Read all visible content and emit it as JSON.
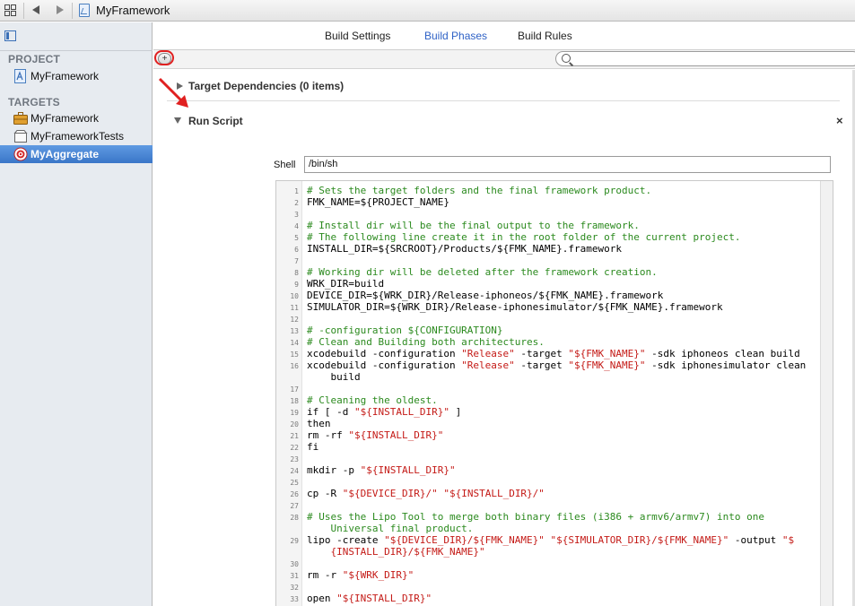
{
  "jumpbar": {
    "title": "MyFramework",
    "icons": [
      "grid-icon",
      "back-arrow-icon",
      "forward-arrow-icon",
      "project-file-icon"
    ]
  },
  "sidebar": {
    "project_header": "PROJECT",
    "project_items": [
      {
        "label": "MyFramework",
        "icon": "project-icon"
      }
    ],
    "targets_header": "TARGETS",
    "target_items": [
      {
        "label": "MyFramework",
        "icon": "framework-toolbox-icon",
        "selected": false
      },
      {
        "label": "MyFrameworkTests",
        "icon": "test-bundle-icon",
        "selected": false
      },
      {
        "label": "MyAggregate",
        "icon": "aggregate-target-icon",
        "selected": true
      }
    ]
  },
  "tabs": [
    {
      "label": "Build Settings",
      "active": false
    },
    {
      "label": "Build Phases",
      "active": true
    },
    {
      "label": "Build Rules",
      "active": false
    }
  ],
  "filter": {
    "search_placeholder": ""
  },
  "phases": {
    "target_dependencies": "Target Dependencies (0 items)",
    "run_script": "Run Script",
    "close_symbol": "×",
    "shell_label": "Shell",
    "shell_value": "/bin/sh"
  },
  "code_lines": [
    {
      "n": "1",
      "segs": [
        {
          "t": "# Sets the target folders and the final framework product.",
          "k": "c"
        }
      ]
    },
    {
      "n": "2",
      "segs": [
        {
          "t": "FMK_NAME=${PROJECT_NAME}",
          "k": ""
        }
      ]
    },
    {
      "n": "3",
      "segs": []
    },
    {
      "n": "4",
      "segs": [
        {
          "t": "# Install dir will be the final output to the framework.",
          "k": "c"
        }
      ]
    },
    {
      "n": "5",
      "segs": [
        {
          "t": "# The following line create it in the root folder of the current project.",
          "k": "c"
        }
      ]
    },
    {
      "n": "6",
      "segs": [
        {
          "t": "INSTALL_DIR=${SRCROOT}/Products/${FMK_NAME}.framework",
          "k": ""
        }
      ]
    },
    {
      "n": "7",
      "segs": []
    },
    {
      "n": "8",
      "segs": [
        {
          "t": "# Working dir will be deleted after the framework creation.",
          "k": "c"
        }
      ]
    },
    {
      "n": "9",
      "segs": [
        {
          "t": "WRK_DIR=build",
          "k": ""
        }
      ]
    },
    {
      "n": "10",
      "segs": [
        {
          "t": "DEVICE_DIR=${WRK_DIR}/Release-iphoneos/${FMK_NAME}.framework",
          "k": ""
        }
      ]
    },
    {
      "n": "11",
      "segs": [
        {
          "t": "SIMULATOR_DIR=${WRK_DIR}/Release-iphonesimulator/${FMK_NAME}.framework",
          "k": ""
        }
      ]
    },
    {
      "n": "12",
      "segs": []
    },
    {
      "n": "13",
      "segs": [
        {
          "t": "# -configuration ${CONFIGURATION}",
          "k": "c"
        }
      ]
    },
    {
      "n": "14",
      "segs": [
        {
          "t": "# Clean and Building both architectures.",
          "k": "c"
        }
      ]
    },
    {
      "n": "15",
      "segs": [
        {
          "t": "xcodebuild -configuration ",
          "k": ""
        },
        {
          "t": "\"Release\"",
          "k": "s"
        },
        {
          "t": " -target ",
          "k": ""
        },
        {
          "t": "\"${FMK_NAME}\"",
          "k": "s"
        },
        {
          "t": " -sdk iphoneos clean build",
          "k": ""
        }
      ]
    },
    {
      "n": "16",
      "segs": [
        {
          "t": "xcodebuild -configuration ",
          "k": ""
        },
        {
          "t": "\"Release\"",
          "k": "s"
        },
        {
          "t": " -target ",
          "k": ""
        },
        {
          "t": "\"${FMK_NAME}\"",
          "k": "s"
        },
        {
          "t": " -sdk iphonesimulator clean",
          "k": ""
        }
      ]
    },
    {
      "n": "",
      "segs": [
        {
          "t": "    build",
          "k": ""
        }
      ]
    },
    {
      "n": "17",
      "segs": []
    },
    {
      "n": "18",
      "segs": [
        {
          "t": "# Cleaning the oldest.",
          "k": "c"
        }
      ]
    },
    {
      "n": "19",
      "segs": [
        {
          "t": "if [ -d ",
          "k": ""
        },
        {
          "t": "\"${INSTALL_DIR}\"",
          "k": "s"
        },
        {
          "t": " ]",
          "k": ""
        }
      ]
    },
    {
      "n": "20",
      "segs": [
        {
          "t": "then",
          "k": ""
        }
      ]
    },
    {
      "n": "21",
      "segs": [
        {
          "t": "rm -rf ",
          "k": ""
        },
        {
          "t": "\"${INSTALL_DIR}\"",
          "k": "s"
        }
      ]
    },
    {
      "n": "22",
      "segs": [
        {
          "t": "fi",
          "k": ""
        }
      ]
    },
    {
      "n": "23",
      "segs": []
    },
    {
      "n": "24",
      "segs": [
        {
          "t": "mkdir -p ",
          "k": ""
        },
        {
          "t": "\"${INSTALL_DIR}\"",
          "k": "s"
        }
      ]
    },
    {
      "n": "25",
      "segs": []
    },
    {
      "n": "26",
      "segs": [
        {
          "t": "cp -R ",
          "k": ""
        },
        {
          "t": "\"${DEVICE_DIR}/\"",
          "k": "s"
        },
        {
          "t": " ",
          "k": ""
        },
        {
          "t": "\"${INSTALL_DIR}/\"",
          "k": "s"
        }
      ]
    },
    {
      "n": "27",
      "segs": []
    },
    {
      "n": "28",
      "segs": [
        {
          "t": "# Uses the Lipo Tool to merge both binary files (i386 + armv6/armv7) into one",
          "k": "c"
        }
      ]
    },
    {
      "n": "",
      "segs": [
        {
          "t": "    Universal final product.",
          "k": "c"
        }
      ]
    },
    {
      "n": "29",
      "segs": [
        {
          "t": "lipo -create ",
          "k": ""
        },
        {
          "t": "\"${DEVICE_DIR}/${FMK_NAME}\"",
          "k": "s"
        },
        {
          "t": " ",
          "k": ""
        },
        {
          "t": "\"${SIMULATOR_DIR}/${FMK_NAME}\"",
          "k": "s"
        },
        {
          "t": " -output ",
          "k": ""
        },
        {
          "t": "\"$",
          "k": "s"
        }
      ]
    },
    {
      "n": "",
      "segs": [
        {
          "t": "    {INSTALL_DIR}/${FMK_NAME}\"",
          "k": "s"
        }
      ]
    },
    {
      "n": "30",
      "segs": []
    },
    {
      "n": "31",
      "segs": [
        {
          "t": "rm -r ",
          "k": ""
        },
        {
          "t": "\"${WRK_DIR}\"",
          "k": "s"
        }
      ]
    },
    {
      "n": "32",
      "segs": []
    },
    {
      "n": "33",
      "segs": [
        {
          "t": "open ",
          "k": ""
        },
        {
          "t": "\"${INSTALL_DIR}\"",
          "k": "s"
        }
      ]
    }
  ],
  "colors": {
    "accent": "#2f62c6",
    "selection": "#3a76c8",
    "comment": "#2b8a1e",
    "string": "#c41a16",
    "annotation": "#e02020"
  }
}
